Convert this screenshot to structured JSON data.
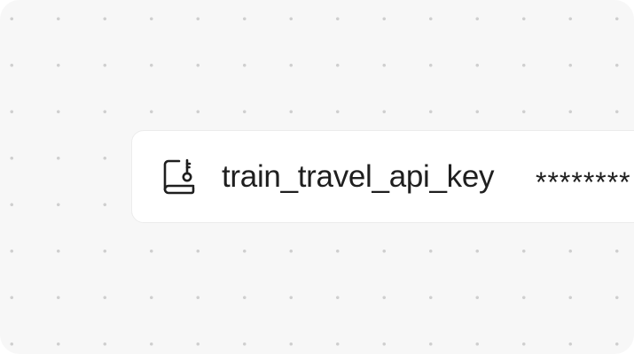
{
  "secret": {
    "icon": "secret-key-icon",
    "name": "train_travel_api_key",
    "masked_value": "********"
  },
  "colors": {
    "background": "#f7f7f7",
    "dot": "#cfcfcf",
    "card": "#ffffff",
    "text": "#1f1f1f"
  }
}
